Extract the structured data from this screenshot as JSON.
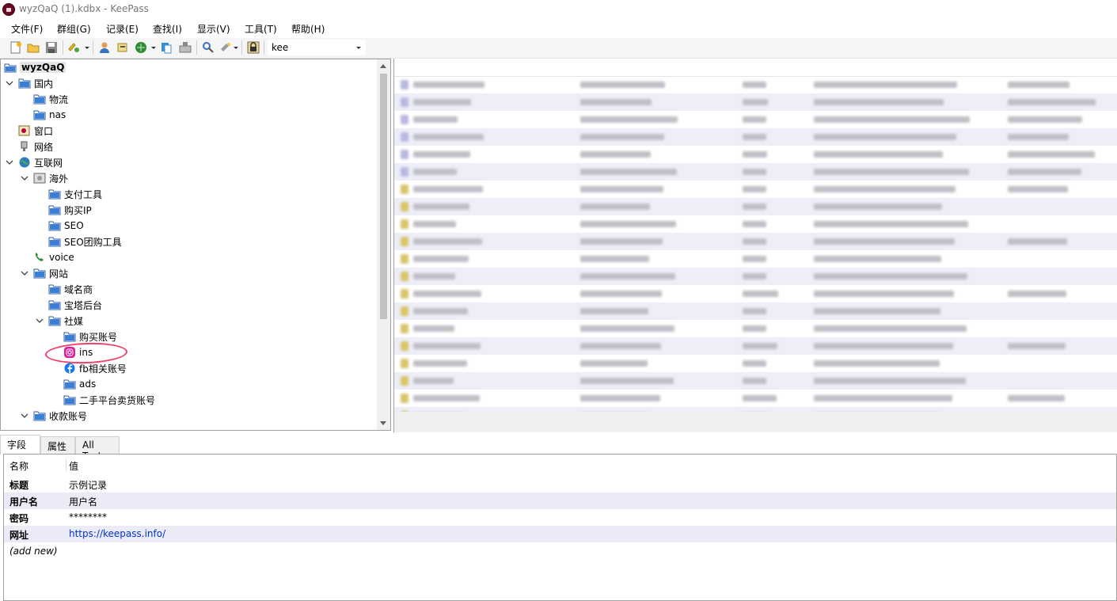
{
  "window": {
    "title": "wyzQaQ (1).kdbx - KeePass"
  },
  "menu": [
    "文件(F)",
    "群组(G)",
    "记录(E)",
    "查找(I)",
    "显示(V)",
    "工具(T)",
    "帮助(H)"
  ],
  "toolbar": {
    "icons": [
      "new-database-icon",
      "open-database-icon",
      "save-icon",
      "add-entry-icon",
      "copy-username-icon",
      "copy-password-icon",
      "open-url-icon",
      "clipboard-icon",
      "autotype-icon",
      "find-icon",
      "password-generator-icon",
      "lock-icon"
    ],
    "quick_search_value": "kee"
  },
  "tree": {
    "root": "wyzQaQ",
    "nodes": [
      {
        "label": "国内",
        "icon": "folder-icon"
      },
      {
        "label": "物流",
        "icon": "folder-icon"
      },
      {
        "label": "nas",
        "icon": "folder-icon"
      },
      {
        "label": "窗口",
        "icon": "window-icon"
      },
      {
        "label": "网络",
        "icon": "network-icon"
      },
      {
        "label": "互联网",
        "icon": "globe-icon"
      },
      {
        "label": "海外",
        "icon": "safe-icon"
      },
      {
        "label": "支付工具",
        "icon": "folder-icon"
      },
      {
        "label": "购买IP",
        "icon": "folder-icon"
      },
      {
        "label": "SEO",
        "icon": "folder-icon"
      },
      {
        "label": "SEO团购工具",
        "icon": "folder-icon"
      },
      {
        "label": "voice",
        "icon": "phone-icon"
      },
      {
        "label": "网站",
        "icon": "folder-icon"
      },
      {
        "label": "域名商",
        "icon": "folder-icon"
      },
      {
        "label": "宝塔后台",
        "icon": "folder-icon"
      },
      {
        "label": "社媒",
        "icon": "folder-icon"
      },
      {
        "label": "购买账号",
        "icon": "folder-icon"
      },
      {
        "label": "ins",
        "icon": "instagram-icon"
      },
      {
        "label": "fb相关账号",
        "icon": "facebook-icon"
      },
      {
        "label": "ads",
        "icon": "folder-icon"
      },
      {
        "label": "二手平台卖货账号",
        "icon": "folder-icon"
      },
      {
        "label": "收款账号",
        "icon": "folder-icon"
      }
    ]
  },
  "details": {
    "tabs": [
      "字段",
      "属性",
      "All Text"
    ],
    "header": {
      "name": "名称",
      "value": "值"
    },
    "fields": [
      {
        "name": "标题",
        "value": "示例记录"
      },
      {
        "name": "用户名",
        "value": "用户名"
      },
      {
        "name": "密码",
        "value": "********"
      },
      {
        "name": "网址",
        "value": "https://keepass.info/"
      }
    ],
    "add_new": "(add new)"
  }
}
